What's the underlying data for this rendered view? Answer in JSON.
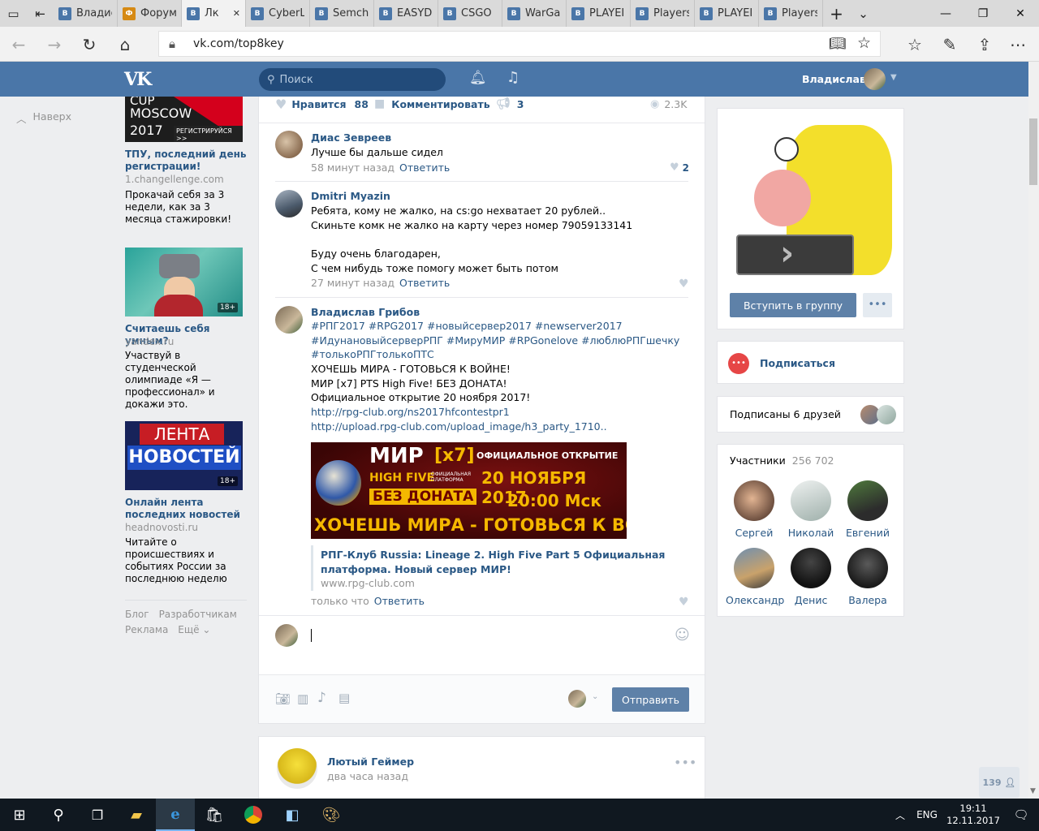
{
  "browser": {
    "tabs": [
      {
        "label": "Владис",
        "fav_color": "#4a76a8",
        "fav": "В"
      },
      {
        "label": "Форум",
        "fav_color": "#d68a14",
        "fav": "Ф"
      },
      {
        "label": "Лк",
        "fav_color": "#4a76a8",
        "fav": "В",
        "active": true
      },
      {
        "label": "CyberL",
        "fav_color": "#4a76a8",
        "fav": "В"
      },
      {
        "label": "Semch",
        "fav_color": "#4a76a8",
        "fav": "В"
      },
      {
        "label": "EASYD",
        "fav_color": "#4a76a8",
        "fav": "В"
      },
      {
        "label": "CSGO",
        "fav_color": "#4a76a8",
        "fav": "В"
      },
      {
        "label": "WarGa",
        "fav_color": "#4a76a8",
        "fav": "В"
      },
      {
        "label": "PLAYEI",
        "fav_color": "#4a76a8",
        "fav": "В"
      },
      {
        "label": "Players",
        "fav_color": "#4a76a8",
        "fav": "В"
      },
      {
        "label": "PLAYEI",
        "fav_color": "#4a76a8",
        "fav": "В"
      },
      {
        "label": "Players",
        "fav_color": "#4a76a8",
        "fav": "В"
      }
    ],
    "url": "vk.com/top8key"
  },
  "vk": {
    "search_placeholder": "Поиск",
    "user_name": "Владислав",
    "back_to_top": "Наверх",
    "accent": "#4a76a8"
  },
  "ads": [
    {
      "img_line1": "CUP",
      "img_line2": "MOSCOW",
      "img_line3": "2017",
      "img_cta": "РЕГИСТРИРУЙСЯ >>",
      "title": "ТПУ, последний день регистрации!",
      "src": "1.changellenge.com",
      "text": "Прокачай себя за 3 недели, как за 3 месяца стажировки!"
    },
    {
      "badge": "18+",
      "title": "Считаешь себя умным?",
      "src": "yandex.ru",
      "text": "Участвуй в студенческой олимпиаде «Я — профессионал» и докажи это."
    },
    {
      "img_line1": "ЛЕНТА",
      "img_line2": "НОВОСТЕЙ",
      "badge": "18+",
      "title": "Онлайн лента последних новостей",
      "src": "headnovosti.ru",
      "text": "Читайте о происшествиях и событиях России за последнюю неделю"
    }
  ],
  "footer_links": {
    "blog": "Блог",
    "dev": "Разработчикам",
    "ads": "Реклама",
    "more": "Ещё"
  },
  "post_actions": {
    "like_label": "Нравится",
    "like_count": "88",
    "comment_label": "Комментировать",
    "share_count": "3",
    "views": "2.3K"
  },
  "comments": [
    {
      "name": "Диас Зевреев",
      "lines": [
        "Лучше бы дальше сидел"
      ],
      "time": "58 минут назад",
      "reply": "Ответить",
      "likes": "2"
    },
    {
      "name": "Dmitri Myazin",
      "lines": [
        "Ребята, кому не жалко, на cs:go нехватает 20 рублей..",
        "Скиньте комк не жалко на карту через номер 79059133141",
        "",
        "Буду очень благодарен,",
        "С чем нибудь тоже помогу может быть потом"
      ],
      "time": "27 минут назад",
      "reply": "Ответить"
    },
    {
      "name": "Владислав Грибов",
      "hashtags": [
        "#РПГ2017 #RPG2017 #новыйсервер2017 #newserver2017",
        "#ИдунановыйсерверРПГ #МируМИР #RPGonelove #люблюРПГшечку",
        "#толькоРПГтолькоПТС"
      ],
      "lines": [
        "ХОЧЕШЬ МИРА - ГОТОВЬСЯ К ВОЙНЕ!",
        "МИР [x7] PTS High Five! БЕЗ ДОНАТА!",
        "Официальное открытие 20 ноября 2017!"
      ],
      "links": [
        "http://rpg-club.org/ns2017hfcontestpr1",
        "http://upload.rpg-club.com/upload_image/h3_party_1710.."
      ],
      "banner": {
        "l1": "МИР",
        "l2": "[x7]",
        "l3": "HIGH FIVE",
        "l3b": "ОФИЦИАЛЬНАЯ ПЛАТФОРМА",
        "l4": "БЕЗ ДОНАТА",
        "r1": "ОФИЦИАЛЬНОЕ ОТКРЫТИЕ",
        "r2": "20 НОЯБРЯ 2017",
        "r3": "20:00 Мск",
        "bottom": "ХОЧЕШЬ МИРА - ГОТОВЬСЯ К ВОЙНЕ"
      },
      "attach_title": "РПГ-Клуб Russia: Lineage 2. High Five Part 5 Официальная платформа. Новый сервер МИР!",
      "attach_domain": "www.rpg-club.com",
      "time": "только что",
      "reply": "Ответить"
    }
  ],
  "composer": {
    "send": "Отправить"
  },
  "next_post": {
    "name": "Лютый Геймер",
    "time": "два часа назад"
  },
  "group": {
    "join": "Вступить в группу",
    "subscribe": "Подписаться",
    "friends": "Подписаны 6 друзей",
    "members_label": "Участники",
    "members_count": "256 702",
    "members": [
      {
        "name": "Сергей"
      },
      {
        "name": "Николай"
      },
      {
        "name": "Евгений"
      },
      {
        "name": "Олександр"
      },
      {
        "name": "Денис"
      },
      {
        "name": "Валера"
      }
    ]
  },
  "online_count": "139",
  "taskbar": {
    "lang": "ENG",
    "time": "19:11",
    "date": "12.11.2017"
  }
}
